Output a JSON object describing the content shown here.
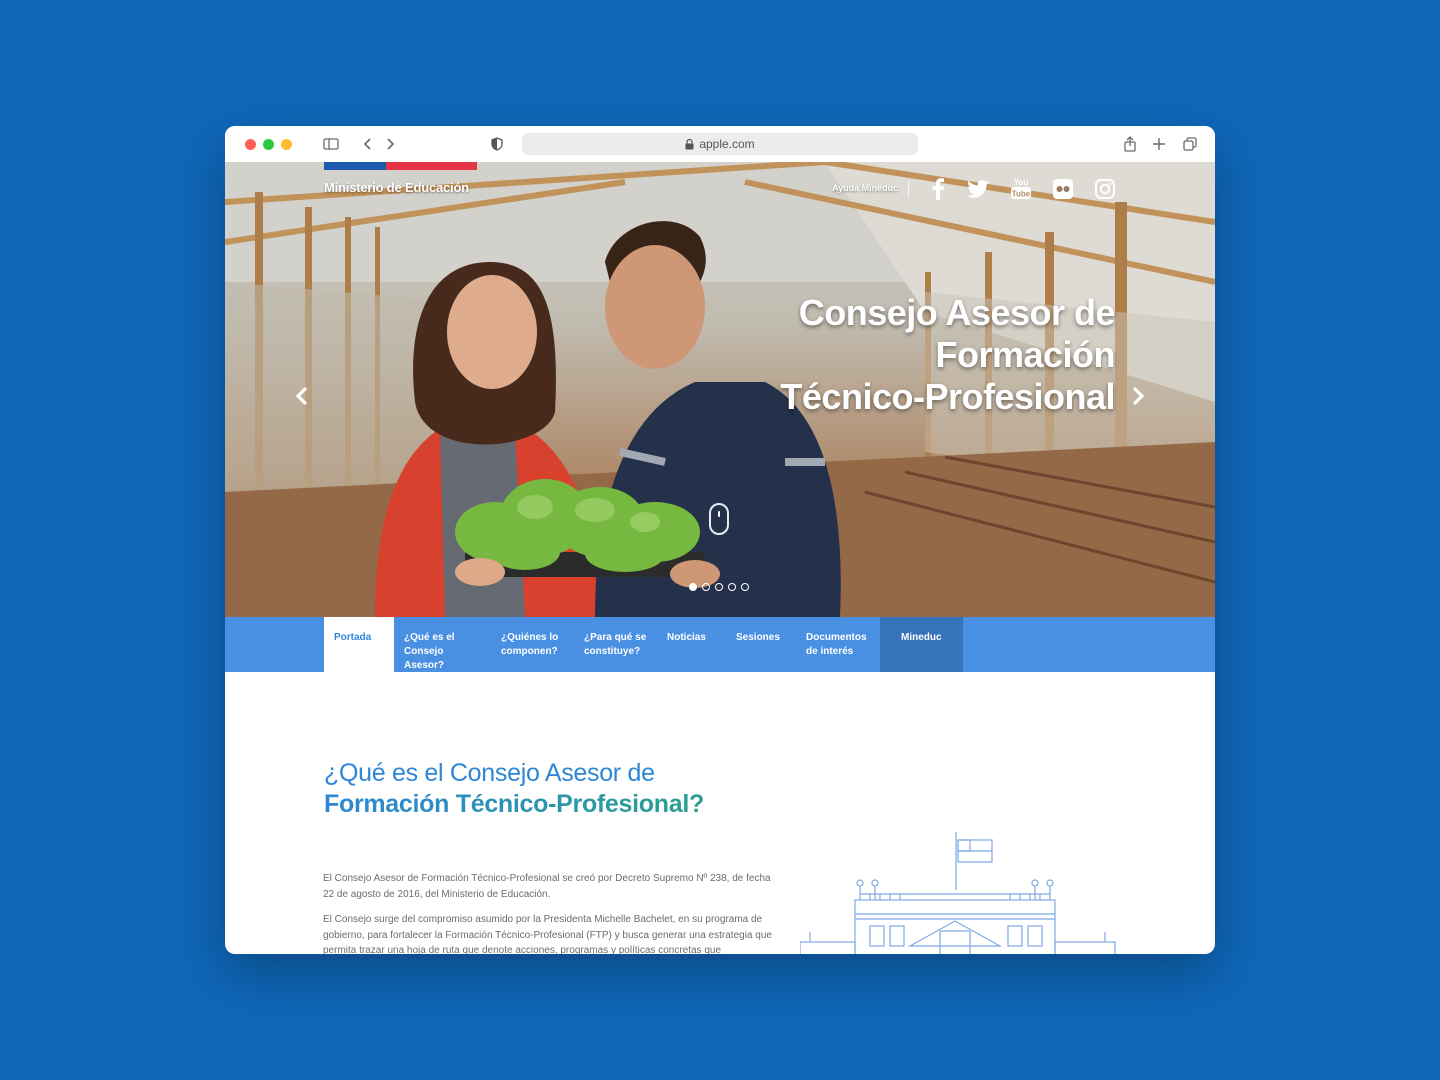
{
  "browser": {
    "url": "apple.com"
  },
  "header": {
    "ministry": "Ministerio de Educación",
    "help_link": "Ayuda Mineduc",
    "social": [
      "facebook-icon",
      "twitter-icon",
      "youtube-icon",
      "flickr-icon",
      "instagram-icon"
    ]
  },
  "hero": {
    "title_line1": "Consejo Asesor de",
    "title_line2": "Formación",
    "title_line3": "Técnico-Profesional",
    "slides_total": 5,
    "active_slide": 1
  },
  "nav": {
    "items": [
      {
        "line1": "Portada",
        "line2": ""
      },
      {
        "line1": "¿Qué es el",
        "line2": "Consejo Asesor?"
      },
      {
        "line1": "¿Quiénes lo",
        "line2": "componen?"
      },
      {
        "line1": "¿Para qué se",
        "line2": "constituye?"
      },
      {
        "line1": "Noticias",
        "line2": ""
      },
      {
        "line1": "Sesiones",
        "line2": ""
      },
      {
        "line1": "Documentos",
        "line2": "de interés"
      },
      {
        "line1": "Mineduc",
        "line2": ""
      }
    ]
  },
  "content": {
    "heading_line1": "¿Qué es el Consejo Asesor de",
    "heading_line2": "Formación Técnico-Profesional?",
    "paragraph1": "El Consejo Asesor de Formación Técnico-Profesional se creó por Decreto Supremo Nº 238, de fecha 22 de agosto de 2016, del Ministerio de Educación.",
    "paragraph2": "El Consejo surge del compromiso asumido por la Presidenta Michelle Bachelet, en su programa de gobierno, para fortalecer la Formación Técnico-Profesional (FTP) y busca generar una estrategia que permita trazar una hoja de ruta que denote acciones, programas y políticas concretas que"
  },
  "colors": {
    "background": "#0F67B8",
    "nav": "#4A90E2",
    "nav_dark": "#3773B9",
    "heading_blue": "#2E86D6",
    "heading_teal": "#2AA08F",
    "flag_blue": "#1B5AAE",
    "flag_red": "#E73445"
  }
}
